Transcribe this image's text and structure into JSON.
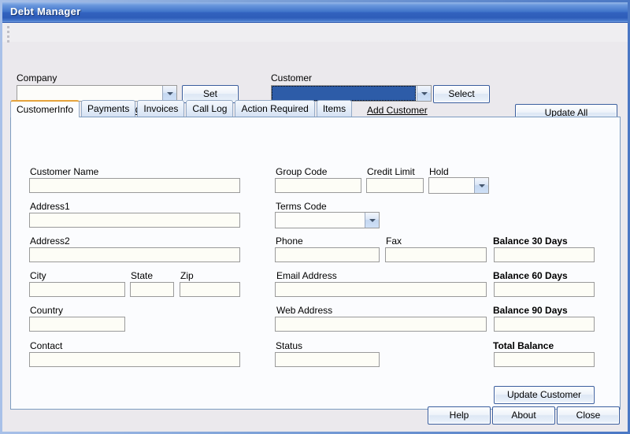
{
  "window": {
    "title": "Debt Manager"
  },
  "top": {
    "company_label": "Company",
    "company_value": "",
    "company_set_button": "Set",
    "add_company_link": "Add Company",
    "customer_label": "Customer",
    "customer_value": "",
    "customer_select_button": "Select",
    "add_customer_link": "Add Customer",
    "update_all_button": "Update All"
  },
  "tabs": [
    {
      "label": "CustomerInfo",
      "active": true
    },
    {
      "label": "Payments",
      "active": false
    },
    {
      "label": "Invoices",
      "active": false
    },
    {
      "label": "Call Log",
      "active": false
    },
    {
      "label": "Action Required",
      "active": false
    },
    {
      "label": "Items",
      "active": false
    }
  ],
  "customer_info": {
    "left": {
      "customer_name_label": "Customer Name",
      "customer_name_value": "",
      "address1_label": "Address1",
      "address1_value": "",
      "address2_label": "Address2",
      "address2_value": "",
      "city_label": "City",
      "city_value": "",
      "state_label": "State",
      "state_value": "",
      "zip_label": "Zip",
      "zip_value": "",
      "country_label": "Country",
      "country_value": "",
      "contact_label": "Contact",
      "contact_value": ""
    },
    "middle": {
      "group_code_label": "Group Code",
      "group_code_value": "",
      "credit_limit_label": "Credit Limit",
      "credit_limit_value": "",
      "hold_label": "Hold",
      "hold_value": "",
      "terms_code_label": "Terms Code",
      "terms_code_value": "",
      "phone_label": "Phone",
      "phone_value": "",
      "fax_label": "Fax",
      "fax_value": "",
      "email_label": "Email Address",
      "email_value": "",
      "web_label": "Web Address",
      "web_value": "",
      "status_label": "Status",
      "status_value": ""
    },
    "right": {
      "balance_30_label": "Balance 30 Days",
      "balance_30_value": "",
      "balance_60_label": "Balance 60 Days",
      "balance_60_value": "",
      "balance_90_label": "Balance 90 Days",
      "balance_90_value": "",
      "total_balance_label": "Total Balance",
      "total_balance_value": "",
      "update_customer_button": "Update Customer"
    }
  },
  "footer": {
    "help_button": "Help",
    "about_button": "About",
    "close_button": "Close"
  },
  "colors": {
    "titlebar_blue": "#3f73c9",
    "window_border": "#4a77c4",
    "active_tab_accent": "#e5a33c",
    "selected_combo": "#2d5ca8",
    "form_background": "#ebe9ed",
    "panel_background": "#fbfcfe"
  }
}
